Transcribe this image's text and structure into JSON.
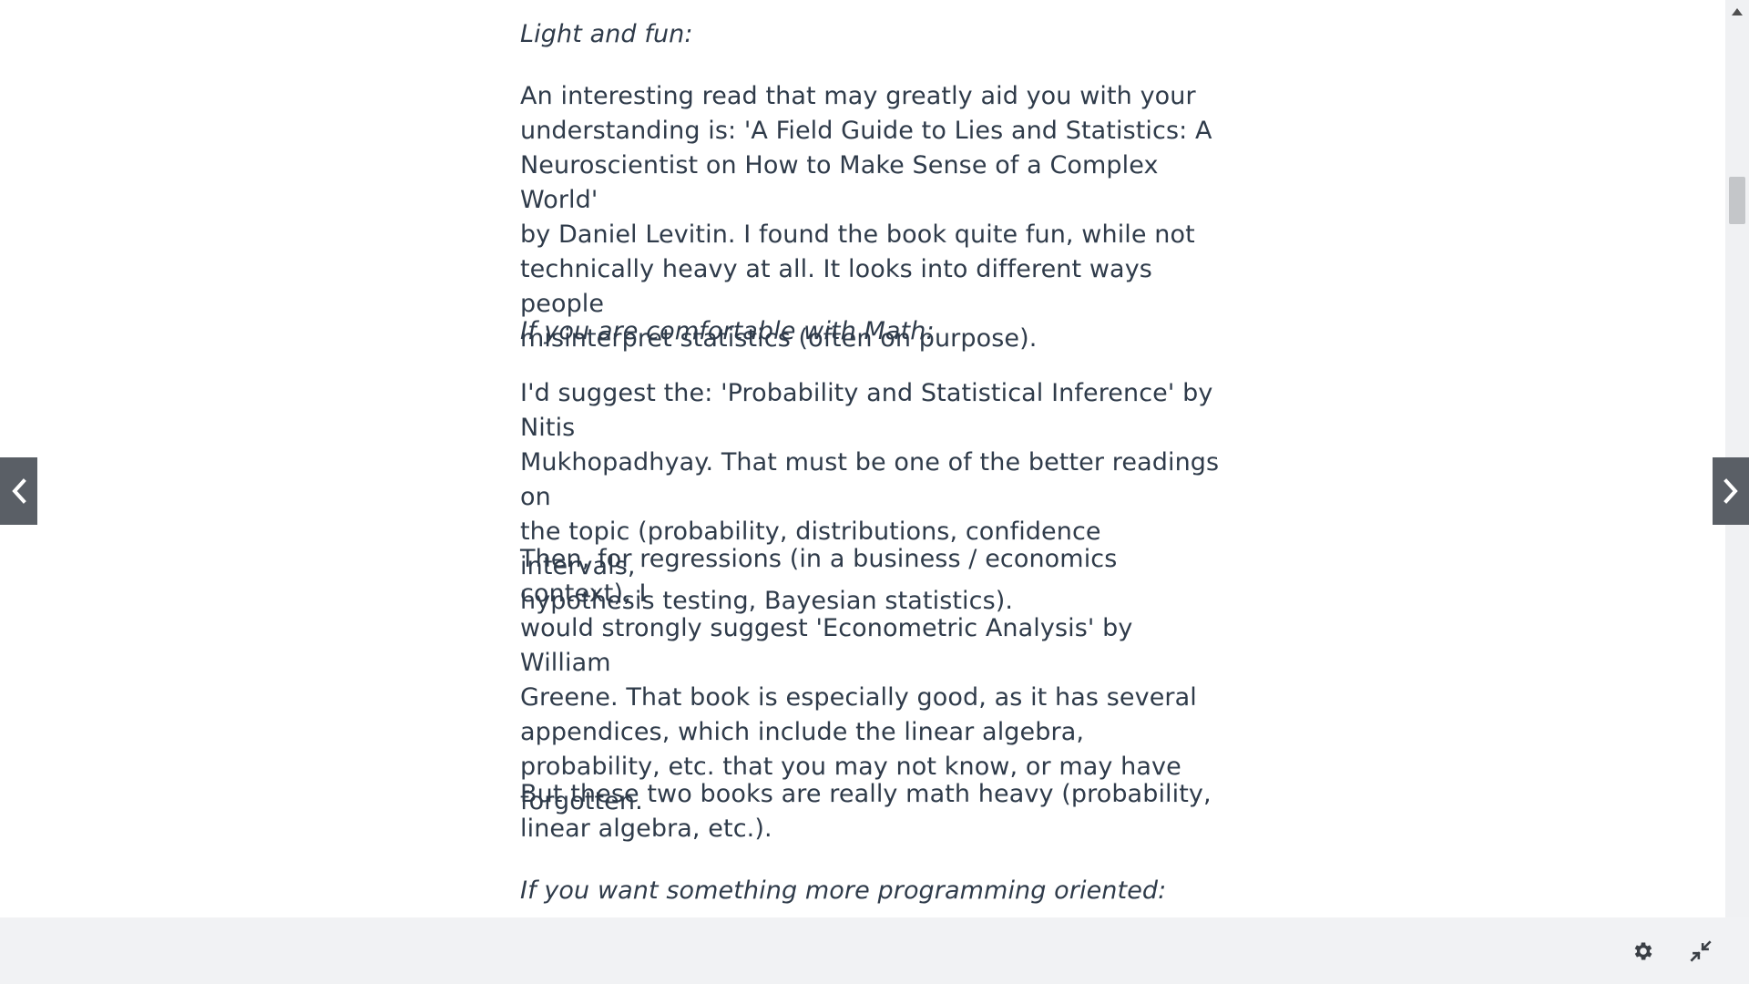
{
  "article": {
    "heading_light": "Light and fun:",
    "para_light": "An interesting read that may greatly aid you with your\nunderstanding is: 'A Field Guide to Lies and Statistics: A\nNeuroscientist on How to Make Sense of a Complex World'\nby Daniel Levitin. I found the book quite fun, while not\ntechnically heavy at all. It looks into different ways people\nmisinterpret statistics (often on purpose).",
    "heading_math": "If you are comfortable with Math:",
    "para_math": "I'd suggest the: 'Probability and Statistical Inference' by Nitis\nMukhopadhyay. That must be one of the better readings on\nthe topic (probability, distributions, confidence intervals,\nhypothesis testing, Bayesian statistics).",
    "para_regress": "Then, for regressions (in a business / economics context), I\nwould strongly suggest 'Econometric Analysis' by William\nGreene. That book is especially good, as it has several\nappendices, which include the linear algebra,\nprobability, etc. that you may not know, or may have\nforgotten.",
    "para_heavy": "But these two books are really math heavy (probability,\nlinear algebra, etc.).",
    "heading_prog": "If you want something more programming oriented:"
  },
  "icons": {
    "prev": "chevron-left-icon",
    "next": "chevron-right-icon",
    "settings": "gear-icon",
    "collapse": "collapse-arrows-icon",
    "scroll_up": "scroll-up-arrow-icon"
  },
  "colors": {
    "text": "#2f3b4a",
    "nav_button": "#5a5f66",
    "bottom_bar": "#f1f2f4",
    "icon": "#3a3f45"
  }
}
